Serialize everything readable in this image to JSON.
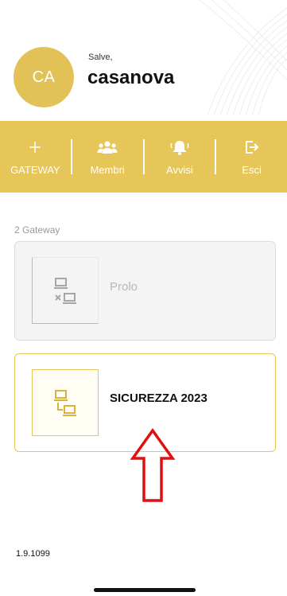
{
  "header": {
    "avatar_initials": "CA",
    "greeting": "Salve,",
    "username": "casanova"
  },
  "toolbar": {
    "items": [
      {
        "label": "GATEWAY",
        "icon": "plus-icon"
      },
      {
        "label": "Membri",
        "icon": "users-icon"
      },
      {
        "label": "Avvisi",
        "icon": "bell-icon"
      },
      {
        "label": "Esci",
        "icon": "exit-icon"
      }
    ]
  },
  "gateways": {
    "count_label": "2 Gateway",
    "items": [
      {
        "name": "Prolo",
        "status": "offline",
        "icon": "gateway-offline-icon"
      },
      {
        "name": "SICUREZZA 2023",
        "status": "online",
        "icon": "gateway-online-icon"
      }
    ]
  },
  "annotation": {
    "icon": "up-arrow-icon",
    "color": "#e01010"
  },
  "footer": {
    "version": "1.9.1099"
  },
  "colors": {
    "accent": "#e6c559",
    "avatar": "#e2c257",
    "card_border_active": "#e6c559",
    "card_bg_inactive": "#f4f4f4"
  }
}
